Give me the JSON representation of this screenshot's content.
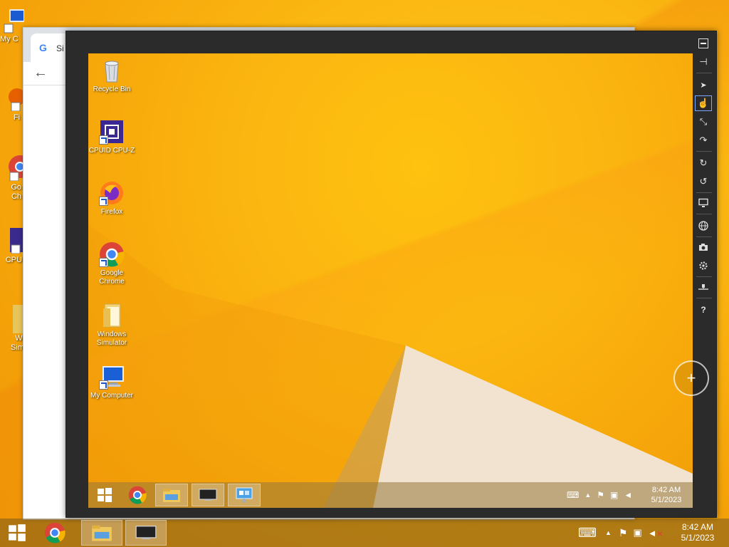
{
  "host": {
    "desktop_icons": [
      {
        "label": "My C"
      },
      {
        "label": "Fi"
      },
      {
        "label": "Go Ch"
      },
      {
        "label": "CPUI"
      },
      {
        "label": "Wi Sim"
      }
    ],
    "chrome_tab_title": "Si",
    "taskbar": {
      "start_label": "Start",
      "time": "8:42 AM",
      "date": "5/1/2023"
    }
  },
  "simulator": {
    "desktop_icons": [
      {
        "label": "Recycle Bin",
        "icon": "recycle-bin-icon"
      },
      {
        "label": "CPUID CPU-Z",
        "icon": "cpuz-icon"
      },
      {
        "label": "Firefox",
        "icon": "firefox-icon"
      },
      {
        "label": "Google Chrome",
        "icon": "chrome-icon"
      },
      {
        "label": "Windows Simulator",
        "icon": "folder-icon"
      },
      {
        "label": "My Computer",
        "icon": "computer-icon"
      }
    ],
    "taskbar": {
      "time": "8:42 AM",
      "date": "5/1/2023"
    },
    "toolbar": [
      {
        "name": "minimize-tool",
        "glyph": "▬"
      },
      {
        "name": "pin-tool",
        "glyph": "⊣"
      },
      {
        "name": "mouse-mode-tool",
        "glyph": "➤"
      },
      {
        "name": "touch-mode-tool",
        "glyph": "☝"
      },
      {
        "name": "pinch-zoom-tool",
        "glyph": "⤡"
      },
      {
        "name": "rotate-tool",
        "glyph": "↷"
      },
      {
        "name": "rotate-clockwise-tool",
        "glyph": "↻"
      },
      {
        "name": "rotate-counterclockwise-tool",
        "glyph": "↺"
      },
      {
        "name": "change-resolution-tool",
        "glyph": "▭"
      },
      {
        "name": "set-location-tool",
        "glyph": "◍"
      },
      {
        "name": "screenshot-tool",
        "glyph": "◉"
      },
      {
        "name": "settings-tool",
        "glyph": "✲"
      },
      {
        "name": "network-tool",
        "glyph": "⏚"
      },
      {
        "name": "help-tool",
        "glyph": "?"
      }
    ],
    "zoom_glyph": "+"
  },
  "colors": {
    "wallpaper": "#f9b00e",
    "sim_frame": "#2b2b2b"
  }
}
